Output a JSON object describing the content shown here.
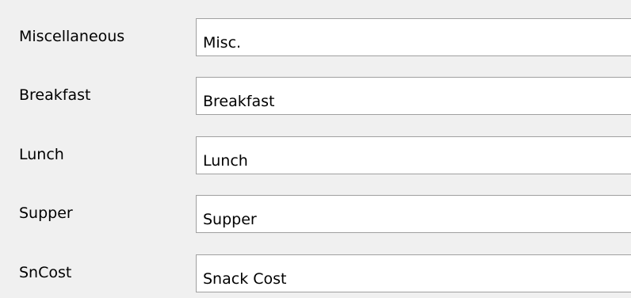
{
  "fields": [
    {
      "label": "Miscellaneous",
      "value": "Misc."
    },
    {
      "label": "Breakfast",
      "value": "Breakfast"
    },
    {
      "label": "Lunch",
      "value": "Lunch"
    },
    {
      "label": "Supper",
      "value": "Supper"
    },
    {
      "label": "SnCost",
      "value": "Snack Cost"
    }
  ],
  "colors": {
    "background": "#f0f0f0",
    "input_background": "#ffffff",
    "input_border": "#a0a0a0",
    "text": "#000000"
  }
}
